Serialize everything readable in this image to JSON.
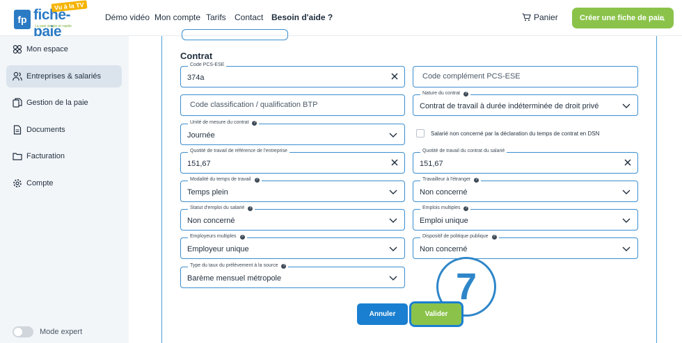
{
  "header": {
    "logo_text": "fiche-paie",
    "logo_badge": "fp",
    "logo_tv": "Vu à la TV",
    "logo_tagline": "La paie simple et rapide",
    "nav": [
      "Démo vidéo",
      "Mon compte",
      "Tarifs",
      "Contact",
      "Besoin d'aide ?"
    ],
    "cart_label": "Panier",
    "cta_label": "Créer une fiche de paie"
  },
  "sidebar": {
    "items": [
      {
        "label": "Mon espace",
        "icon": "dashboard-icon"
      },
      {
        "label": "Entreprises & salariés",
        "icon": "users-icon"
      },
      {
        "label": "Gestion de la paie",
        "icon": "files-icon"
      },
      {
        "label": "Documents",
        "icon": "document-icon"
      },
      {
        "label": "Facturation",
        "icon": "folder-icon"
      },
      {
        "label": "Compte",
        "icon": "gear-icon"
      }
    ],
    "active_index": 1,
    "mode_expert_label": "Mode expert"
  },
  "form": {
    "section_title": "Contrat",
    "code_pcs": {
      "label": "Code PCS-ESE",
      "value": "374a"
    },
    "code_complement": {
      "placeholder": "Code complément PCS-ESE"
    },
    "code_classification": {
      "placeholder": "Code classification / qualification BTP"
    },
    "nature_contrat": {
      "label": "Nature du contrat",
      "value": "Contrat de travail à durée indéterminée de droit privé"
    },
    "unite_mesure": {
      "label": "Unité de mesure du contrat",
      "value": "Journée"
    },
    "salarie_non_concerne": {
      "label": "Salarié non concerné par la déclaration du temps de contrat en DSN",
      "checked": false
    },
    "quotite_entreprise": {
      "label": "Quotité de travail de référence de l'entreprise",
      "value": "151,67"
    },
    "quotite_salarie": {
      "label": "Quotité de travail du contrat du salarié",
      "value": "151,67"
    },
    "modalite_temps": {
      "label": "Modalité du temps de travail",
      "value": "Temps plein"
    },
    "travailleur_etranger": {
      "label": "Travailleur à l'étranger",
      "value": "Non concerné"
    },
    "statut_emploi": {
      "label": "Statut d'emploi du salarié",
      "value": "Non concerné"
    },
    "emplois_multiples": {
      "label": "Emplois multiples",
      "value": "Emploi unique"
    },
    "employeurs_multiples": {
      "label": "Employeurs multiples",
      "value": "Employeur unique"
    },
    "dispositif_politique": {
      "label": "Dispositif de politique publique",
      "value": "Non concerné"
    },
    "type_taux": {
      "label": "Type du taux du prélèvement à la source",
      "value": "Barème mensuel métropole"
    },
    "cancel_label": "Annuler",
    "submit_label": "Valider"
  },
  "step_marker": "7",
  "colors": {
    "brand_blue": "#2b7bc4",
    "brand_green": "#8bc34a",
    "border_blue": "#3a8ed0"
  }
}
